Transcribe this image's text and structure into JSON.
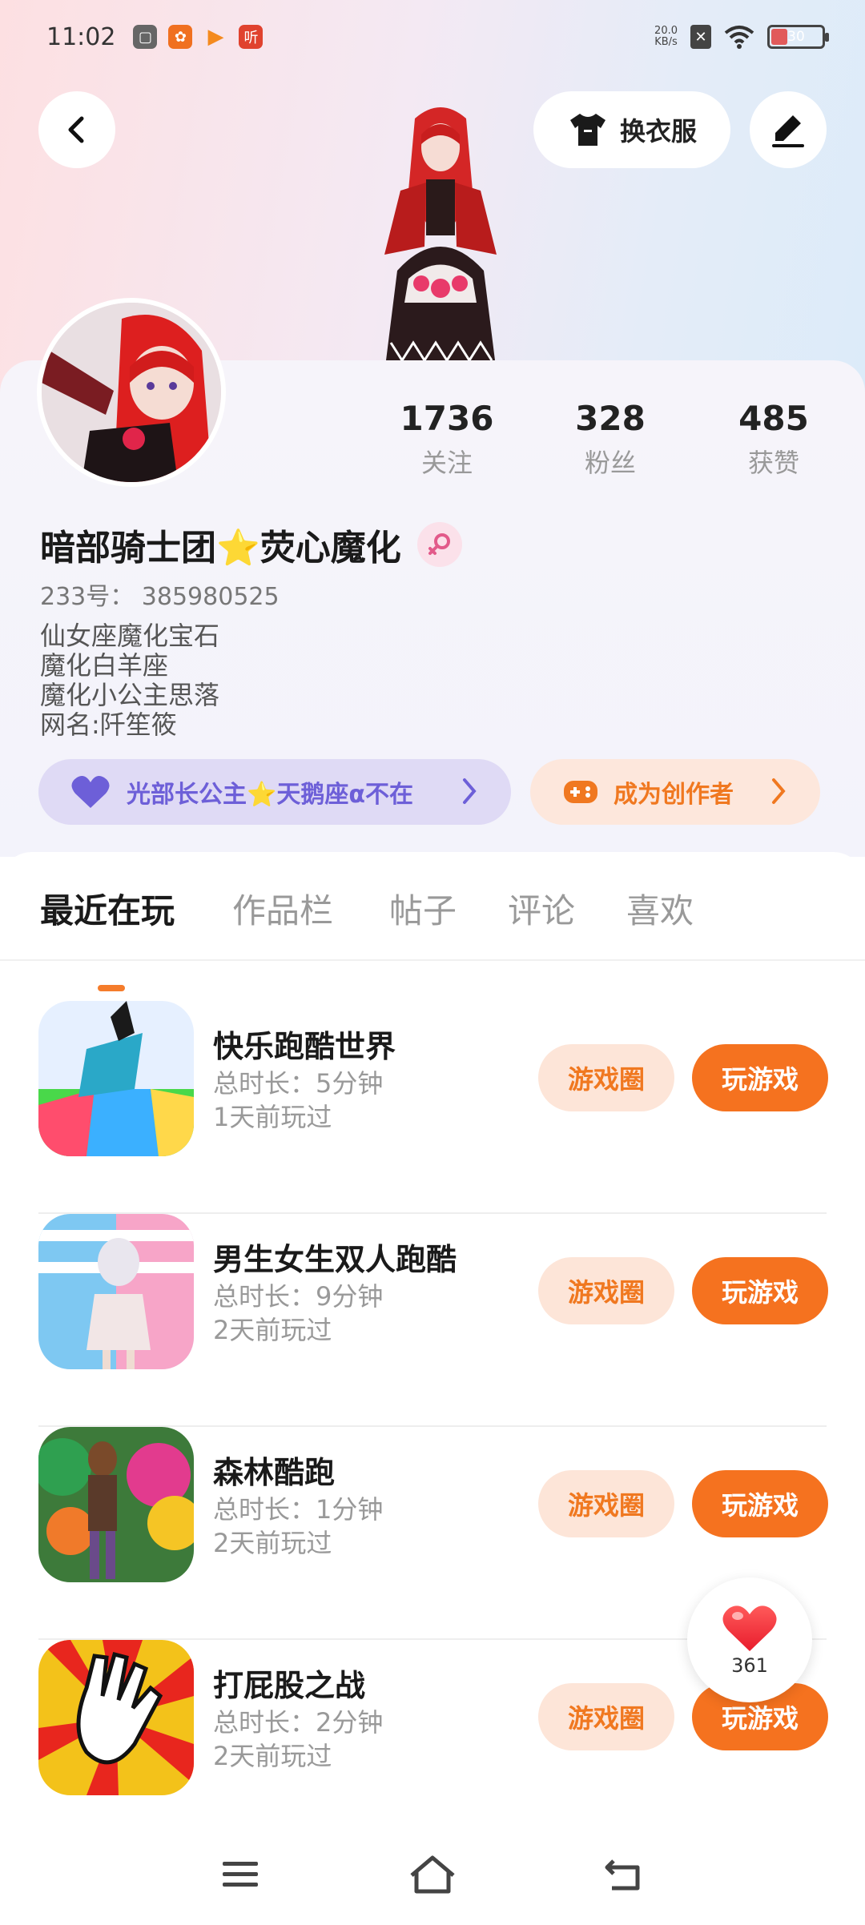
{
  "status_bar": {
    "time": "11:02",
    "net_speed_value": "20.0",
    "net_speed_unit": "KB/s",
    "battery_level": "30",
    "icons": [
      "grey-app-icon",
      "orange-app-icon",
      "play-app-icon",
      "listen-app-icon",
      "close-notification-icon",
      "wifi-icon",
      "battery-icon"
    ]
  },
  "header": {
    "back_icon": "back-arrow-icon",
    "dress_up_label": "换衣服",
    "edit_icon": "edit-pen-icon"
  },
  "profile": {
    "stats": [
      {
        "value": "1736",
        "label": "关注"
      },
      {
        "value": "328",
        "label": "粉丝"
      },
      {
        "value": "485",
        "label": "获赞"
      }
    ],
    "nickname": "暗部骑士团⭐荧心魔化",
    "gender_icon": "female-icon",
    "uid": "233号： 385980525",
    "bio": [
      "仙女座魔化宝石",
      "魔化白羊座",
      "魔化小公主思落",
      "网名:阡笙筱"
    ],
    "guild_chip": "光部长公主⭐天鹅座α不在",
    "creator_chip": "成为创作者"
  },
  "tabs": [
    "最近在玩",
    "作品栏",
    "帖子",
    "评论",
    "喜欢"
  ],
  "games": [
    {
      "title": "快乐跑酷世界",
      "duration": "总时长：5分钟",
      "last_played": "1天前玩过",
      "circle_label": "游戏圈",
      "play_label": "玩游戏"
    },
    {
      "title": "男生女生双人跑酷",
      "duration": "总时长：9分钟",
      "last_played": "2天前玩过",
      "circle_label": "游戏圈",
      "play_label": "玩游戏"
    },
    {
      "title": "森林酷跑",
      "duration": "总时长：1分钟",
      "last_played": "2天前玩过",
      "circle_label": "游戏圈",
      "play_label": "玩游戏"
    },
    {
      "title": "打屁股之战",
      "duration": "总时长：2分钟",
      "last_played": "2天前玩过",
      "circle_label": "游戏圈",
      "play_label": "玩游戏"
    }
  ],
  "like_float": {
    "count": "361"
  },
  "colors": {
    "accent_orange": "#f5721f",
    "chip_purple": "#6d5fd8",
    "light_orange": "#fde5d8"
  }
}
